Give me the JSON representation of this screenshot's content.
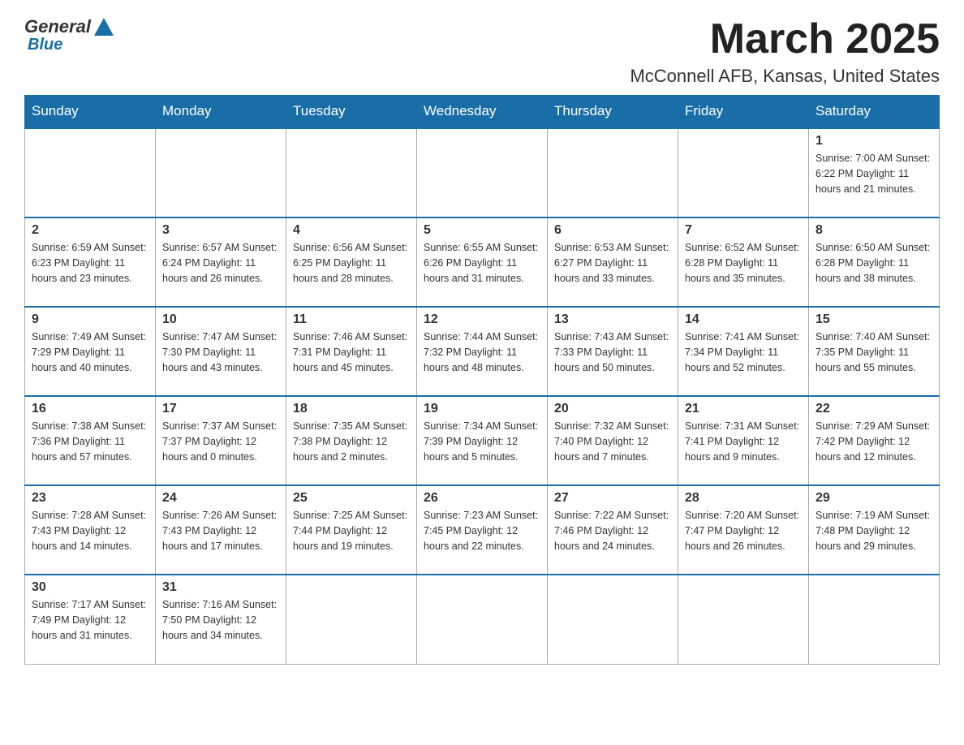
{
  "header": {
    "logo": {
      "general": "General",
      "blue": "Blue"
    },
    "title": "March 2025",
    "location": "McConnell AFB, Kansas, United States"
  },
  "calendar": {
    "days_of_week": [
      "Sunday",
      "Monday",
      "Tuesday",
      "Wednesday",
      "Thursday",
      "Friday",
      "Saturday"
    ],
    "weeks": [
      [
        {
          "day": "",
          "info": ""
        },
        {
          "day": "",
          "info": ""
        },
        {
          "day": "",
          "info": ""
        },
        {
          "day": "",
          "info": ""
        },
        {
          "day": "",
          "info": ""
        },
        {
          "day": "",
          "info": ""
        },
        {
          "day": "1",
          "info": "Sunrise: 7:00 AM\nSunset: 6:22 PM\nDaylight: 11 hours\nand 21 minutes."
        }
      ],
      [
        {
          "day": "2",
          "info": "Sunrise: 6:59 AM\nSunset: 6:23 PM\nDaylight: 11 hours\nand 23 minutes."
        },
        {
          "day": "3",
          "info": "Sunrise: 6:57 AM\nSunset: 6:24 PM\nDaylight: 11 hours\nand 26 minutes."
        },
        {
          "day": "4",
          "info": "Sunrise: 6:56 AM\nSunset: 6:25 PM\nDaylight: 11 hours\nand 28 minutes."
        },
        {
          "day": "5",
          "info": "Sunrise: 6:55 AM\nSunset: 6:26 PM\nDaylight: 11 hours\nand 31 minutes."
        },
        {
          "day": "6",
          "info": "Sunrise: 6:53 AM\nSunset: 6:27 PM\nDaylight: 11 hours\nand 33 minutes."
        },
        {
          "day": "7",
          "info": "Sunrise: 6:52 AM\nSunset: 6:28 PM\nDaylight: 11 hours\nand 35 minutes."
        },
        {
          "day": "8",
          "info": "Sunrise: 6:50 AM\nSunset: 6:28 PM\nDaylight: 11 hours\nand 38 minutes."
        }
      ],
      [
        {
          "day": "9",
          "info": "Sunrise: 7:49 AM\nSunset: 7:29 PM\nDaylight: 11 hours\nand 40 minutes."
        },
        {
          "day": "10",
          "info": "Sunrise: 7:47 AM\nSunset: 7:30 PM\nDaylight: 11 hours\nand 43 minutes."
        },
        {
          "day": "11",
          "info": "Sunrise: 7:46 AM\nSunset: 7:31 PM\nDaylight: 11 hours\nand 45 minutes."
        },
        {
          "day": "12",
          "info": "Sunrise: 7:44 AM\nSunset: 7:32 PM\nDaylight: 11 hours\nand 48 minutes."
        },
        {
          "day": "13",
          "info": "Sunrise: 7:43 AM\nSunset: 7:33 PM\nDaylight: 11 hours\nand 50 minutes."
        },
        {
          "day": "14",
          "info": "Sunrise: 7:41 AM\nSunset: 7:34 PM\nDaylight: 11 hours\nand 52 minutes."
        },
        {
          "day": "15",
          "info": "Sunrise: 7:40 AM\nSunset: 7:35 PM\nDaylight: 11 hours\nand 55 minutes."
        }
      ],
      [
        {
          "day": "16",
          "info": "Sunrise: 7:38 AM\nSunset: 7:36 PM\nDaylight: 11 hours\nand 57 minutes."
        },
        {
          "day": "17",
          "info": "Sunrise: 7:37 AM\nSunset: 7:37 PM\nDaylight: 12 hours\nand 0 minutes."
        },
        {
          "day": "18",
          "info": "Sunrise: 7:35 AM\nSunset: 7:38 PM\nDaylight: 12 hours\nand 2 minutes."
        },
        {
          "day": "19",
          "info": "Sunrise: 7:34 AM\nSunset: 7:39 PM\nDaylight: 12 hours\nand 5 minutes."
        },
        {
          "day": "20",
          "info": "Sunrise: 7:32 AM\nSunset: 7:40 PM\nDaylight: 12 hours\nand 7 minutes."
        },
        {
          "day": "21",
          "info": "Sunrise: 7:31 AM\nSunset: 7:41 PM\nDaylight: 12 hours\nand 9 minutes."
        },
        {
          "day": "22",
          "info": "Sunrise: 7:29 AM\nSunset: 7:42 PM\nDaylight: 12 hours\nand 12 minutes."
        }
      ],
      [
        {
          "day": "23",
          "info": "Sunrise: 7:28 AM\nSunset: 7:43 PM\nDaylight: 12 hours\nand 14 minutes."
        },
        {
          "day": "24",
          "info": "Sunrise: 7:26 AM\nSunset: 7:43 PM\nDaylight: 12 hours\nand 17 minutes."
        },
        {
          "day": "25",
          "info": "Sunrise: 7:25 AM\nSunset: 7:44 PM\nDaylight: 12 hours\nand 19 minutes."
        },
        {
          "day": "26",
          "info": "Sunrise: 7:23 AM\nSunset: 7:45 PM\nDaylight: 12 hours\nand 22 minutes."
        },
        {
          "day": "27",
          "info": "Sunrise: 7:22 AM\nSunset: 7:46 PM\nDaylight: 12 hours\nand 24 minutes."
        },
        {
          "day": "28",
          "info": "Sunrise: 7:20 AM\nSunset: 7:47 PM\nDaylight: 12 hours\nand 26 minutes."
        },
        {
          "day": "29",
          "info": "Sunrise: 7:19 AM\nSunset: 7:48 PM\nDaylight: 12 hours\nand 29 minutes."
        }
      ],
      [
        {
          "day": "30",
          "info": "Sunrise: 7:17 AM\nSunset: 7:49 PM\nDaylight: 12 hours\nand 31 minutes."
        },
        {
          "day": "31",
          "info": "Sunrise: 7:16 AM\nSunset: 7:50 PM\nDaylight: 12 hours\nand 34 minutes."
        },
        {
          "day": "",
          "info": ""
        },
        {
          "day": "",
          "info": ""
        },
        {
          "day": "",
          "info": ""
        },
        {
          "day": "",
          "info": ""
        },
        {
          "day": "",
          "info": ""
        }
      ]
    ]
  }
}
